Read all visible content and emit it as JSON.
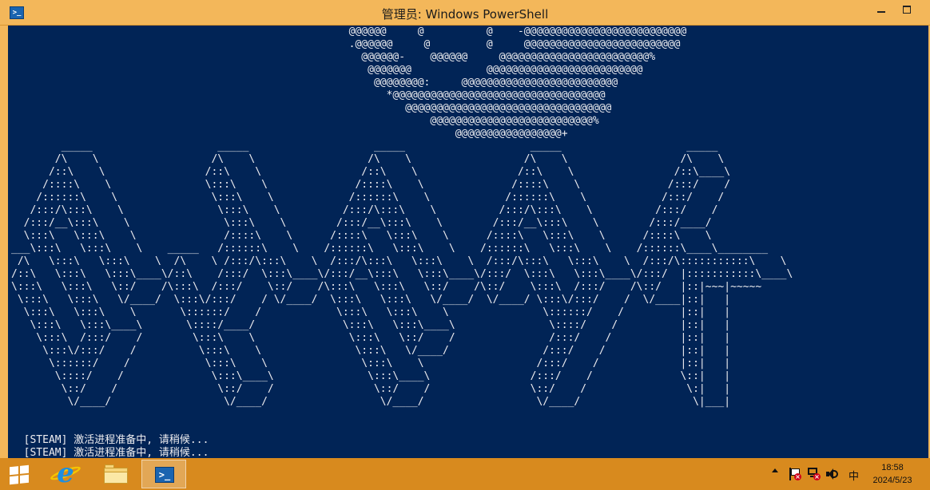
{
  "window": {
    "title": "管理员: Windows PowerShell",
    "app_icon": "powershell-icon",
    "app_icon_glyph": ">_"
  },
  "console": {
    "background": "#012456",
    "foreground": "#eeedf0",
    "lines": [
      "                                                      @@@@@@     @          @    -@@@@@@@@@@@@@@@@@@@@@@@@@@",
      "                                                      .@@@@@@     @         @     @@@@@@@@@@@@@@@@@@@@@@@@@",
      "                                                        @@@@@@-    @@@@@@     @@@@@@@@@@@@@@@@@@@@@@@@%",
      "                                                         @@@@@@@            @@@@@@@@@@@@@@@@@@@@@@@@@",
      "                                                          @@@@@@@@:     @@@@@@@@@@@@@@@@@@@@@@@@@",
      "                                                            *@@@@@@@@@@@@@@@@@@@@@@@@@@@@@@@@@@",
      "                                                               @@@@@@@@@@@@@@@@@@@@@@@@@@@@@@@@@",
      "                                                                   @@@@@@@@@@@@@@@@@@@@@@@@@@%",
      "                                                                       @@@@@@@@@@@@@@@@@+",
      "        _____                    _____                    _____                    _____                    _____",
      "       /\\    \\                  /\\    \\                  /\\    \\                  /\\    \\                  /\\    \\",
      "      /::\\    \\                /::\\    \\                /::\\    \\                /::\\    \\                /::\\____\\",
      "     /::::\\    \\               \\:::\\    \\              /::::\\    \\              /::::\\    \\              /:::/    /",
      "    /::::::\\    \\               \\:::\\    \\            /::::::\\    \\            /::::::\\    \\            /:::/    /",
      "   /:::/\\:::\\    \\               \\:::\\    \\          /:::/\\:::\\    \\          /:::/\\:::\\    \\          /:::/    /",
      "  /:::/__\\:::\\    \\               \\:::\\    \\        /:::/__\\:::\\    \\        /:::/__\\:::\\    \\        /:::/____/",
      "  \\:::\\   \\:::\\    \\              /::::\\    \\      /::::\\   \\:::\\    \\      /::::\\   \\:::\\    \\      /::::\\    \\",
      "___\\:::\\   \\:::\\    \\    _____   /::::::\\    \\    /::::::\\   \\:::\\    \\    /::::::\\   \\:::\\    \\    /::::::\\____\\________",
      " /\\   \\:::\\   \\:::\\    \\  /\\    \\ /:::/\\:::\\    \\  /:::/\\:::\\   \\:::\\    \\  /:::/\\:::\\   \\:::\\    \\  /:::/\\:::::::::::\\    \\",
      "/::\\   \\:::\\   \\:::\\____\\/::\\    /:::/  \\:::\\____\\/:::/__\\:::\\   \\:::\\____\\/:::/  \\:::\\   \\:::\\____\\/:::/  |:::::::::::\\____\\",
      "\\:::\\   \\:::\\   \\::/    /\\:::\\  /:::/    \\::/    /\\:::\\   \\:::\\   \\::/    /\\::/    \\:::\\  /:::/    /\\::/   |::|~~~|~~~~~",
      " \\:::\\   \\:::\\   \\/____/  \\:::\\/:::/    / \\/____/  \\:::\\   \\:::\\   \\/____/  \\/____/ \\:::\\/:::/    /  \\/____|::|   |",
      "  \\:::\\   \\:::\\    \\       \\::::::/    /            \\:::\\   \\:::\\    \\               \\::::::/    /         |::|   |",
      "   \\:::\\   \\:::\\____\\       \\::::/____/              \\:::\\   \\:::\\____\\               \\::::/    /          |::|   |",
      "    \\:::\\  /:::/    /        \\:::\\    \\               \\:::\\   \\::/    /               /:::/    /           |::|   |",
      "     \\:::\\/:::/    /          \\:::\\    \\               \\:::\\   \\/____/               /:::/    /            |::|   |",
      "      \\::::::/    /            \\:::\\    \\               \\:::\\    \\                  /:::/    /             |::|   |",
      "       \\::::/    /              \\:::\\____\\               \\:::\\____\\                /:::/    /              \\::|   |",
      "        \\::/    /                \\::/    /                \\::/    /                \\::/    /                \\:|   |",
      "         \\/____/                  \\/____/                  \\/____/                  \\/____/                  \\|___|",
      "",
      "",
      "  [STEAM] 激活进程准备中, 请稍候...",
      "  [STEAM] 激活进程准备中, 请稍候..."
    ]
  },
  "taskbar": {
    "start_icon": "windows-logo-icon",
    "apps": [
      {
        "name": "internet-explorer",
        "icon": "ie-icon",
        "glyph": "e"
      },
      {
        "name": "file-explorer",
        "icon": "folder-icon"
      },
      {
        "name": "windows-powershell",
        "icon": "powershell-icon",
        "glyph": ">_",
        "active": true
      }
    ],
    "tray": {
      "ime": "中",
      "time": "18:58",
      "date": "2024/5/23"
    },
    "color": "#d88a1e"
  },
  "titlebar_color": "#f3b75a"
}
